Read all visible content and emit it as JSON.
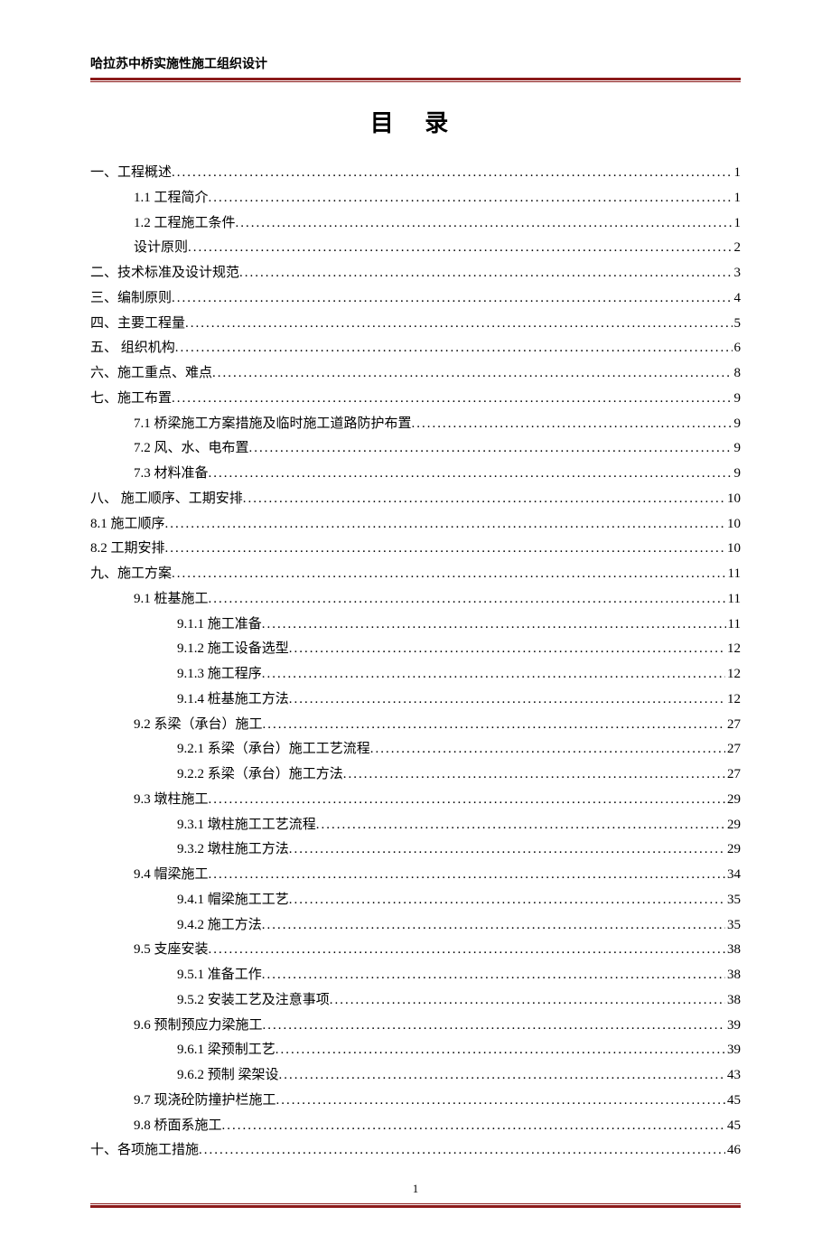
{
  "header_text": "哈拉苏中桥实施性施工组织设计",
  "title": "目  录",
  "page_number": "1",
  "toc": [
    {
      "level": 0,
      "label": "一、工程概述",
      "page": "1"
    },
    {
      "level": 1,
      "label": "1.1 工程简介",
      "page": "1"
    },
    {
      "level": 1,
      "label": "1.2 工程施工条件",
      "page": "1"
    },
    {
      "level": 1,
      "label": "设计原则",
      "page": "2"
    },
    {
      "level": 0,
      "label": "二、技术标准及设计规范",
      "page": "3"
    },
    {
      "level": 0,
      "label": "三、编制原则",
      "page": "4"
    },
    {
      "level": 0,
      "label": "四、主要工程量",
      "page": "5"
    },
    {
      "level": 0,
      "label": "五、  组织机构",
      "page": "6"
    },
    {
      "level": 0,
      "label": "六、施工重点、难点",
      "page": "8"
    },
    {
      "level": 0,
      "label": "七、施工布置",
      "page": "9"
    },
    {
      "level": 1,
      "label": "7.1 桥梁施工方案措施及临时施工道路防护布置",
      "page": "9"
    },
    {
      "level": 1,
      "label": "7.2 风、水、电布置",
      "page": "9"
    },
    {
      "level": 1,
      "label": "7.3 材料准备",
      "page": "9"
    },
    {
      "level": 0,
      "label": "八、  施工顺序、工期安排",
      "page": "10"
    },
    {
      "level": 0,
      "label": "8.1 施工顺序",
      "page": "10",
      "dotstyle": "mid"
    },
    {
      "level": 0,
      "label": "8.2 工期安排",
      "page": "10"
    },
    {
      "level": 0,
      "label": "九、施工方案",
      "page": "11"
    },
    {
      "level": 1,
      "label": "9.1 桩基施工",
      "page": "11"
    },
    {
      "level": 2,
      "label": "9.1.1 施工准备",
      "page": "11"
    },
    {
      "level": 2,
      "label": "9.1.2 施工设备选型",
      "page": "12"
    },
    {
      "level": 2,
      "label": "9.1.3 施工程序",
      "page": "12"
    },
    {
      "level": 2,
      "label": "9.1.4 桩基施工方法",
      "page": "12"
    },
    {
      "level": 1,
      "label": "9.2 系梁（承台）施工",
      "page": "27"
    },
    {
      "level": 2,
      "label": "9.2.1  系梁（承台）施工工艺流程",
      "page": "27"
    },
    {
      "level": 2,
      "label": "9.2.2 系梁（承台）施工方法",
      "page": "27"
    },
    {
      "level": 1,
      "label": "9.3 墩柱施工",
      "page": "29"
    },
    {
      "level": 2,
      "label": "9.3.1 墩柱施工工艺流程",
      "page": "29"
    },
    {
      "level": 2,
      "label": "9.3.2 墩柱施工方法",
      "page": "29"
    },
    {
      "level": 1,
      "label": "9.4 帽梁施工",
      "page": "34"
    },
    {
      "level": 2,
      "label": "9.4.1 帽梁施工工艺",
      "page": "35"
    },
    {
      "level": 2,
      "label": "9.4.2 施工方法",
      "page": "35"
    },
    {
      "level": 1,
      "label": "9.5 支座安装",
      "page": "38"
    },
    {
      "level": 2,
      "label": "9.5.1 准备工作",
      "page": "38"
    },
    {
      "level": 2,
      "label": "9.5.2 安装工艺及注意事项",
      "page": "38"
    },
    {
      "level": 1,
      "label": "9.6 预制预应力梁施工",
      "page": "39"
    },
    {
      "level": 2,
      "label": "9.6.1 梁预制工艺",
      "page": "39"
    },
    {
      "level": 2,
      "label": "9.6.2 预制  梁架设",
      "page": "43"
    },
    {
      "level": 1,
      "label": "9.7 现浇砼防撞护栏施工",
      "page": "45"
    },
    {
      "level": 1,
      "label": "9.8 桥面系施工",
      "page": "45"
    },
    {
      "level": 0,
      "label": "十、各项施工措施",
      "page": "46"
    }
  ]
}
